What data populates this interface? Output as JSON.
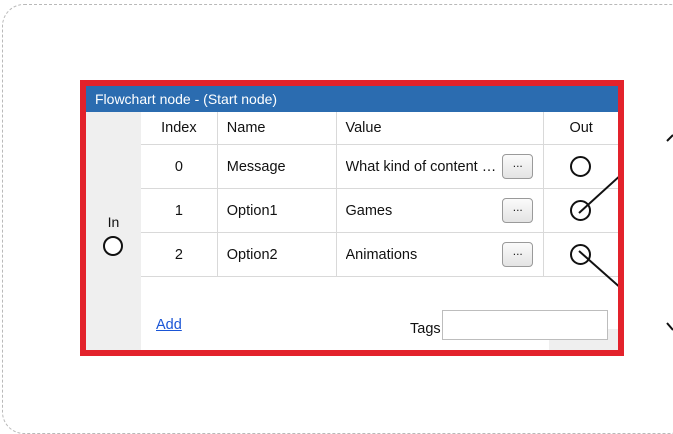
{
  "node": {
    "title": "Flowchart node - (Start node)",
    "in_label": "In",
    "add_label": "Add",
    "tags_label": "Tags",
    "tags_value": "",
    "button_label": "...",
    "columns": {
      "index": "Index",
      "name": "Name",
      "value": "Value",
      "out": "Out"
    },
    "rows": [
      {
        "index": "0",
        "name": "Message",
        "value": "What kind of content do you like?"
      },
      {
        "index": "1",
        "name": "Option1",
        "value": "Games"
      },
      {
        "index": "2",
        "name": "Option2",
        "value": "Animations"
      }
    ]
  },
  "colors": {
    "header": "#2b6cb0",
    "selection_border": "#e3222b",
    "link": "#1a55d6"
  }
}
